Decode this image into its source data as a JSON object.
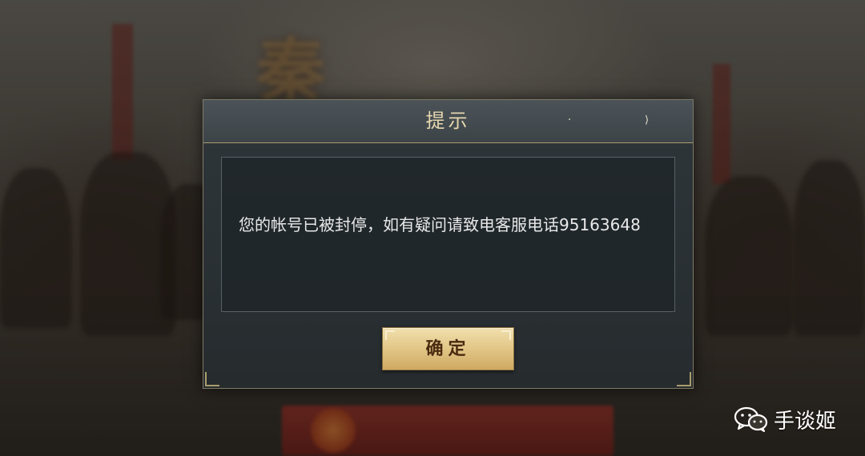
{
  "dialog": {
    "title": "提示",
    "message": "您的帐号已被封停，如有疑问请致电客服电话95163648",
    "confirm_label": "确定"
  },
  "watermark": {
    "icon": "wechat-icon",
    "text": "手谈姬"
  },
  "colors": {
    "dialog_title": "#e6d6ae",
    "message_text": "#e9e9e9",
    "confirm_button_top": "#f1dfae",
    "confirm_button_bottom": "#cfa963",
    "confirm_text": "#4a2b10",
    "accent_border": "#a99c6c"
  }
}
